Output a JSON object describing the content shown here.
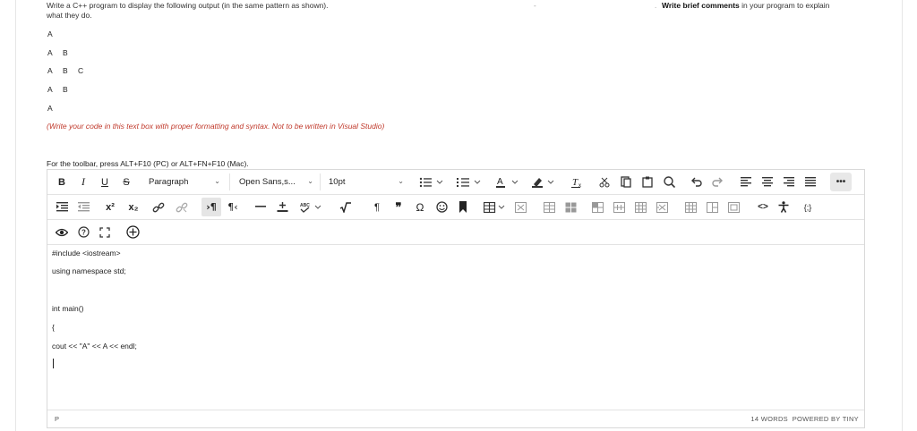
{
  "question": {
    "line1": "Write a C++ program to display the following output (in the same pattern as shown).",
    "line2": "what they do.",
    "right_bold": "Write brief comments",
    "right_rest": " in your program to explain",
    "dot1": "-",
    "dot2": ".",
    "pattern": [
      [
        "A"
      ],
      [
        "A",
        "B"
      ],
      [
        "A",
        "B",
        "C"
      ],
      [
        "A",
        "B"
      ],
      [
        "A"
      ]
    ],
    "note": "(Write your code in this text box with proper formatting and syntax. Not to be written in Visual Studio)",
    "toolbar_hint": "For the toolbar, press ALT+F10 (PC) or ALT+FN+F10 (Mac)."
  },
  "toolbar": {
    "paragraph_select": "Paragraph",
    "font_select": "Open Sans,s...",
    "size_select": "10pt",
    "more_label": "•••",
    "superscript": "x²",
    "subscript": "x₂",
    "bold": "B",
    "italic": "I",
    "underline": "U",
    "strike": "S",
    "pilcrow": "¶",
    "quote": "❞",
    "omega": "Ω",
    "code_label": "<>",
    "braces_label": "{;}"
  },
  "content": {
    "lines": [
      "#include <iostream>",
      "using namespace std;",
      "int main()",
      "{",
      "cout << \"A\" << A << endl;"
    ]
  },
  "status": {
    "path": "P",
    "word_count": "14 WORDS",
    "powered": "POWERED BY TINY"
  },
  "colors": {
    "note": "#c0392b",
    "accent_more": "#e8e8e8"
  }
}
